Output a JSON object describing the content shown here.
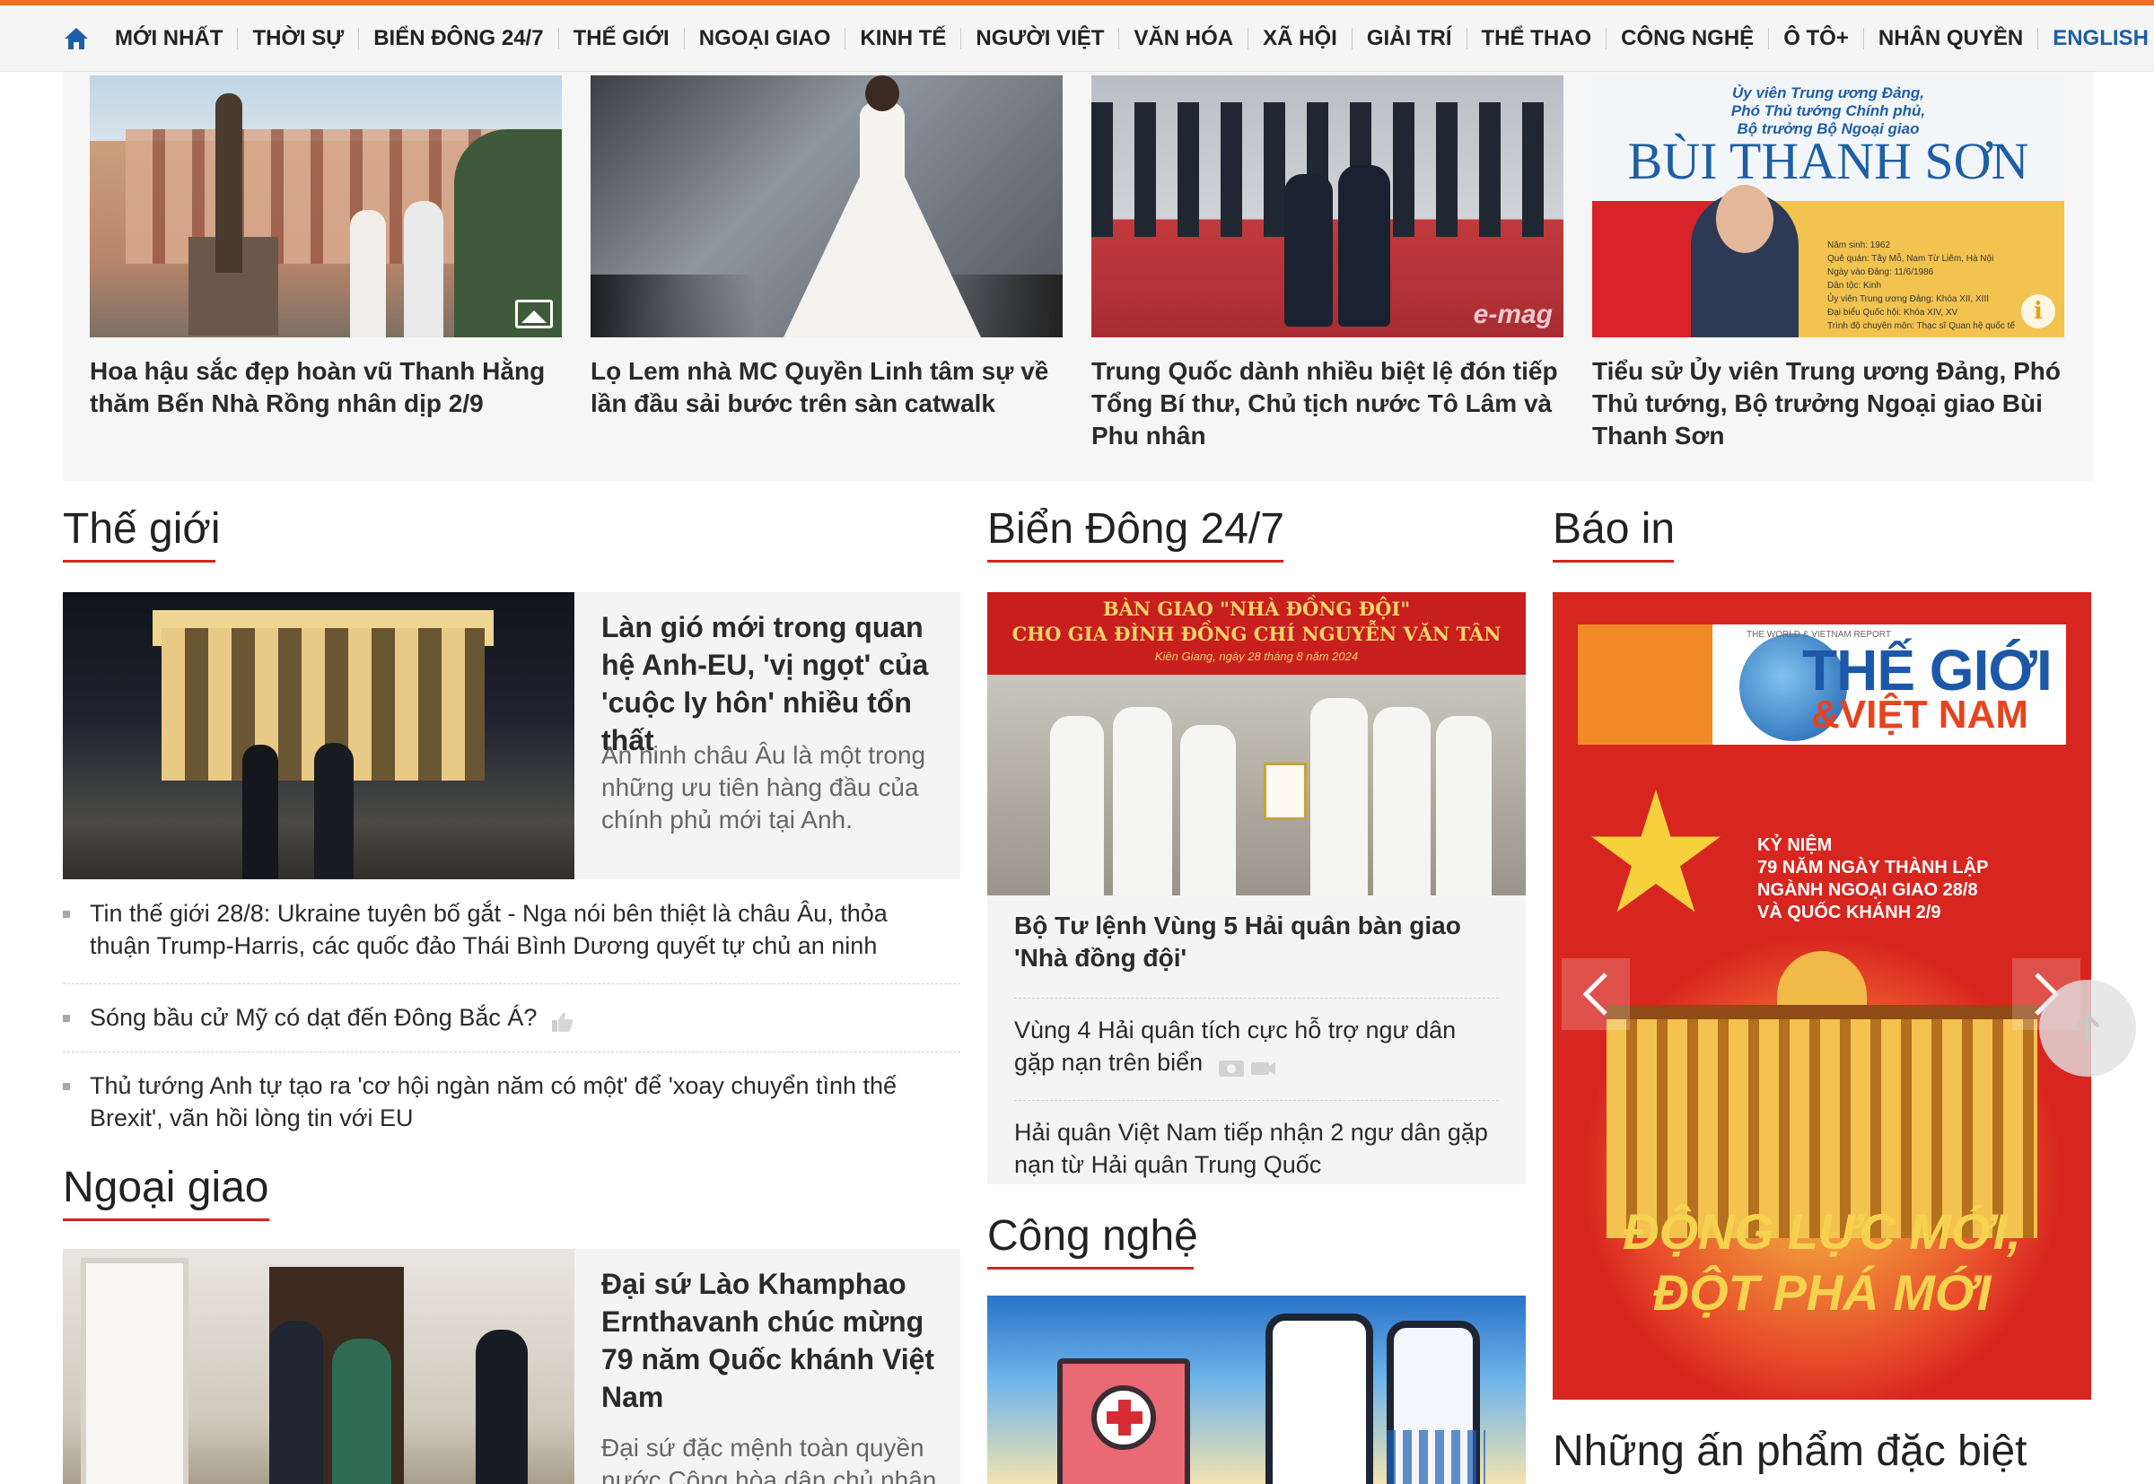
{
  "nav": {
    "items": [
      "MỚI NHẤT",
      "THỜI SỰ",
      "BIỂN ĐÔNG 24/7",
      "THẾ GIỚI",
      "NGOẠI GIAO",
      "KINH TẾ",
      "NGƯỜI VIỆT",
      "VĂN HÓA",
      "XÃ HỘI",
      "GIẢI TRÍ",
      "THỂ THAO",
      "CÔNG NGHỆ",
      "Ô TÔ+",
      "NHÂN QUYỀN"
    ],
    "english": "ENGLISH",
    "home_icon": "home-icon",
    "colors": {
      "accent": "#f26a21",
      "english": "#1b5fa8",
      "section_underline": "#d2261f"
    }
  },
  "featured": [
    {
      "title": "Hoa hậu sắc đẹp hoàn vũ Thanh Hằng thăm Bến Nhà Rồng nhân dịp 2/9",
      "badge_icon": "gallery-icon"
    },
    {
      "title": "Lọ Lem nhà MC Quyền Linh tâm sự về lần đầu sải bước trên sàn catwalk"
    },
    {
      "title": "Trung Quốc dành nhiều biệt lệ đón tiếp Tổng Bí thư, Chủ tịch nước Tô Lâm và Phu nhân",
      "watermark": "e-mag"
    },
    {
      "title": "Tiểu sử Ủy viên Trung ương Đảng, Phó Thủ tướng, Bộ trưởng Ngoại giao Bùi Thanh Sơn",
      "image_text": {
        "subtitle_1": "Ủy viên Trung ương Đảng,",
        "subtitle_2": "Phó Thủ tướng Chính phủ,",
        "subtitle_3": "Bộ trưởng Bộ Ngoại giao",
        "name": "BÙI THANH SƠN",
        "facts": [
          "Năm sinh: 1962",
          "Quê quán: Tây Mỗ, Nam Từ Liêm, Hà Nội",
          "Ngày vào Đảng: 11/6/1986",
          "Dân tộc: Kinh",
          "Ủy viên Trung ương Đảng: Khóa XII, XIII",
          "Đại biểu Quốc hội: Khóa XIV, XV",
          "Trình độ chuyên môn: Thạc sĩ Quan hệ quốc tế"
        ]
      },
      "badge_icon": "info-icon"
    }
  ],
  "the_gioi": {
    "heading": "Thế giới",
    "lead": {
      "title": "Làn gió mới trong quan hệ Anh-EU, 'vị ngọt' của 'cuộc ly hôn' nhiều tổn thất",
      "sapo": "An ninh châu Âu là một trong những ưu tiên hàng đầu của chính phủ mới tại Anh."
    },
    "list": [
      "Tin thế giới 28/8: Ukraine tuyên bố gắt - Nga nói bên thiệt là châu Âu, thỏa thuận Trump-Harris, các quốc đảo Thái Bình Dương quyết tự chủ an ninh",
      "Sóng bầu cử Mỹ có dạt đến Đông Bắc Á?",
      "Thủ tướng Anh tự tạo ra 'cơ hội ngàn năm có một' để 'xoay chuyển tình thế Brexit', vãn hồi lòng tin với EU"
    ]
  },
  "ngoai_giao": {
    "heading": "Ngoại giao",
    "lead": {
      "title": "Đại sứ Lào Khamphao Ernthavanh chúc mừng 79 năm Quốc khánh Việt Nam",
      "sapo": "Đại sứ đặc mệnh toàn quyền nước Cộng hòa dân chủ nhân"
    }
  },
  "bien_dong": {
    "heading": "Biển Đông 24/7",
    "banner": {
      "line1": "BÀN GIAO \"NHÀ ĐỒNG ĐỘI\"",
      "line2": "CHO GIA ĐÌNH ĐỒNG CHÍ NGUYỄN VĂN TÂN",
      "line3": "Kiên Giang, ngày 28 tháng 8 năm 2024"
    },
    "lead_title": "Bộ Tư lệnh Vùng 5 Hải quân bàn giao 'Nhà đồng đội'",
    "list": [
      "Vùng 4 Hải quân tích cực hỗ trợ ngư dân gặp nạn trên biển",
      "Hải quân Việt Nam tiếp nhận 2 ngư dân gặp nạn từ Hải quân Trung Quốc"
    ]
  },
  "cong_nghe": {
    "heading": "Công nghệ"
  },
  "bao_in": {
    "heading": "Báo in",
    "cover": {
      "masthead_1": "THẾ GIỚI",
      "masthead_2": "&VIỆT NAM",
      "report": "THE WORLD & VIETNAM REPORT",
      "anniversary": [
        "KỶ NIỆM",
        "79 NĂM NGÀY THÀNH LẬP",
        "NGÀNH NGOẠI GIAO 28/8",
        "VÀ QUỐC KHÁNH 2/9"
      ],
      "slogan_1": "ĐỘNG LỰC MỚI,",
      "slogan_2": "ĐỘT PHÁ MỚI"
    }
  },
  "special": {
    "heading": "Những ấn phẩm đặc biệt"
  }
}
